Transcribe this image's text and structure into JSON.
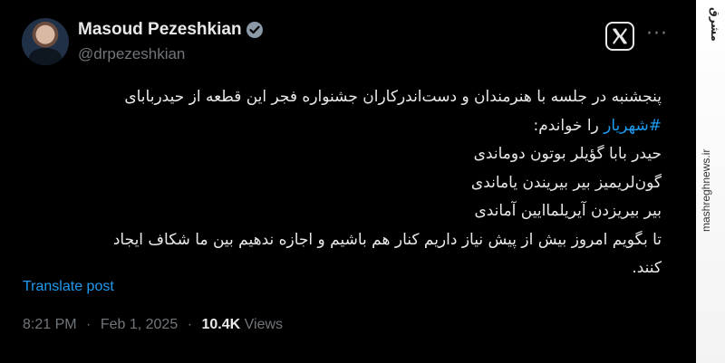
{
  "profile": {
    "name": "Masoud Pezeshkian",
    "handle": "@drpezeshkian",
    "verified_icon": "verified-badge-icon"
  },
  "header": {
    "platform_icon": "x-logo-icon",
    "more_icon": "more-options-icon",
    "more_label": "···"
  },
  "tweet": {
    "lines": [
      "پنجشنبه در جلسه با هنرمندان و دست‌اندرکاران جشنواره فجر این قطعه از حیدربابای",
      "را خواندم:",
      "حیدر بابا گؤیلر بوتون دوماندی",
      "گون‌لریمیز بیر بیریندن یاماندی",
      "بیر بیریزدن آیریلماایین آماندی",
      "تا بگویم امروز بیش از پیش نیاز داریم کنار هم باشیم و اجازه ندهیم بین ما شکاف ایجاد",
      "کنند."
    ],
    "hashtag": "#شهریار",
    "translate_label": "Translate post"
  },
  "meta": {
    "time": "8:21 PM",
    "date": "Feb 1, 2025",
    "separator": "·",
    "views_count": "10.4K",
    "views_label": "Views"
  },
  "watermark": {
    "logo_text": "مشرق",
    "url": "mashreghnews.ir"
  },
  "colors": {
    "background": "#000000",
    "text": "#e7e9ea",
    "muted": "#71767b",
    "link": "#1d9bf0"
  }
}
